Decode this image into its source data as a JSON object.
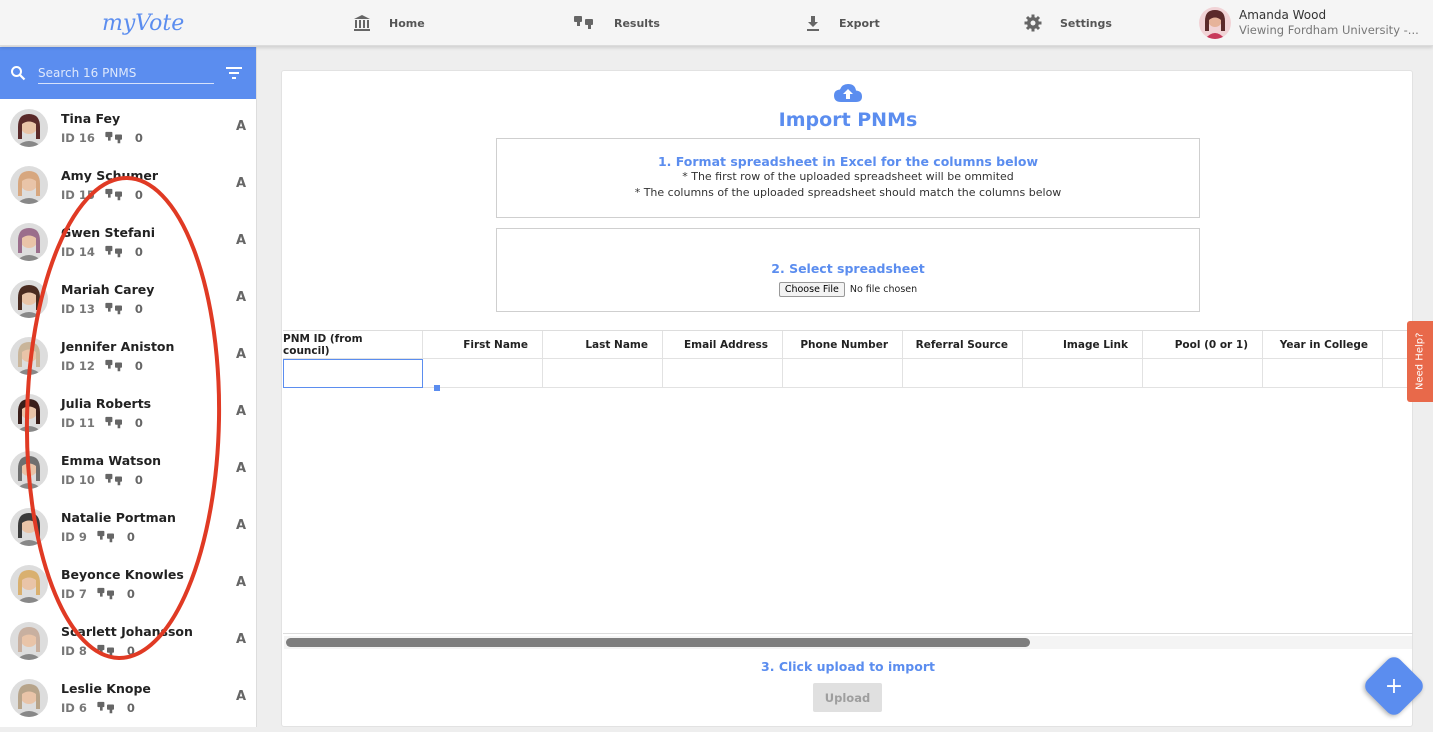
{
  "app": {
    "logo_text": "myVote"
  },
  "nav": [
    {
      "label": "Home",
      "icon": "bank-icon"
    },
    {
      "label": "Results",
      "icon": "thumbs-down-icon"
    },
    {
      "label": "Export",
      "icon": "download-icon"
    },
    {
      "label": "Settings",
      "icon": "gear-icon"
    }
  ],
  "user": {
    "name": "Amanda Wood",
    "subtitle": "Viewing Fordham University -..."
  },
  "sidebar": {
    "search_placeholder": "Search 16 PNMS",
    "pnms": [
      {
        "name": "Tina Fey",
        "id": "ID 16",
        "votes": "0",
        "grade": "A"
      },
      {
        "name": "Amy Schumer",
        "id": "ID 15",
        "votes": "0",
        "grade": "A"
      },
      {
        "name": "Gwen Stefani",
        "id": "ID 14",
        "votes": "0",
        "grade": "A"
      },
      {
        "name": "Mariah Carey",
        "id": "ID 13",
        "votes": "0",
        "grade": "A"
      },
      {
        "name": "Jennifer Aniston",
        "id": "ID 12",
        "votes": "0",
        "grade": "A"
      },
      {
        "name": "Julia Roberts",
        "id": "ID 11",
        "votes": "0",
        "grade": "A"
      },
      {
        "name": "Emma Watson",
        "id": "ID 10",
        "votes": "0",
        "grade": "A"
      },
      {
        "name": "Natalie Portman",
        "id": "ID 9",
        "votes": "0",
        "grade": "A"
      },
      {
        "name": "Beyonce Knowles",
        "id": "ID 7",
        "votes": "0",
        "grade": "A"
      },
      {
        "name": "Scarlett Johansson",
        "id": "ID 8",
        "votes": "0",
        "grade": "A"
      },
      {
        "name": "Leslie Knope",
        "id": "ID 6",
        "votes": "0",
        "grade": "A"
      }
    ],
    "avatar_colors": [
      "#5a2a2a",
      "#d7a77f",
      "#9b6e8c",
      "#4a2b20",
      "#c9b59a",
      "#3a1e1a",
      "#6f6f6f",
      "#3b3b3b",
      "#d9b06f",
      "#c8b0a0",
      "#b7a48a"
    ]
  },
  "main": {
    "title": "Import PNMs",
    "step1_title": "1. Format spreadsheet in Excel for the columns below",
    "step1_note1": "* The first row of the uploaded spreadsheet will be ommited",
    "step1_note2": "* The columns of the uploaded spreadsheet should match the columns below",
    "step2_title": "2. Select spreadsheet",
    "file_button": "Choose File",
    "file_status": "No file chosen",
    "columns": [
      "PNM ID (from council)",
      "First Name",
      "Last Name",
      "Email Address",
      "Phone Number",
      "Referral Source",
      "Image Link",
      "Pool (0 or 1)",
      "Year in College"
    ],
    "step3_title": "3. Click upload to import",
    "upload_label": "Upload"
  },
  "help_tab": "Need Help?",
  "fab_label": "+",
  "colors": {
    "accent": "#5b8def",
    "help": "#e8694a",
    "annotation": "#e03a24"
  }
}
